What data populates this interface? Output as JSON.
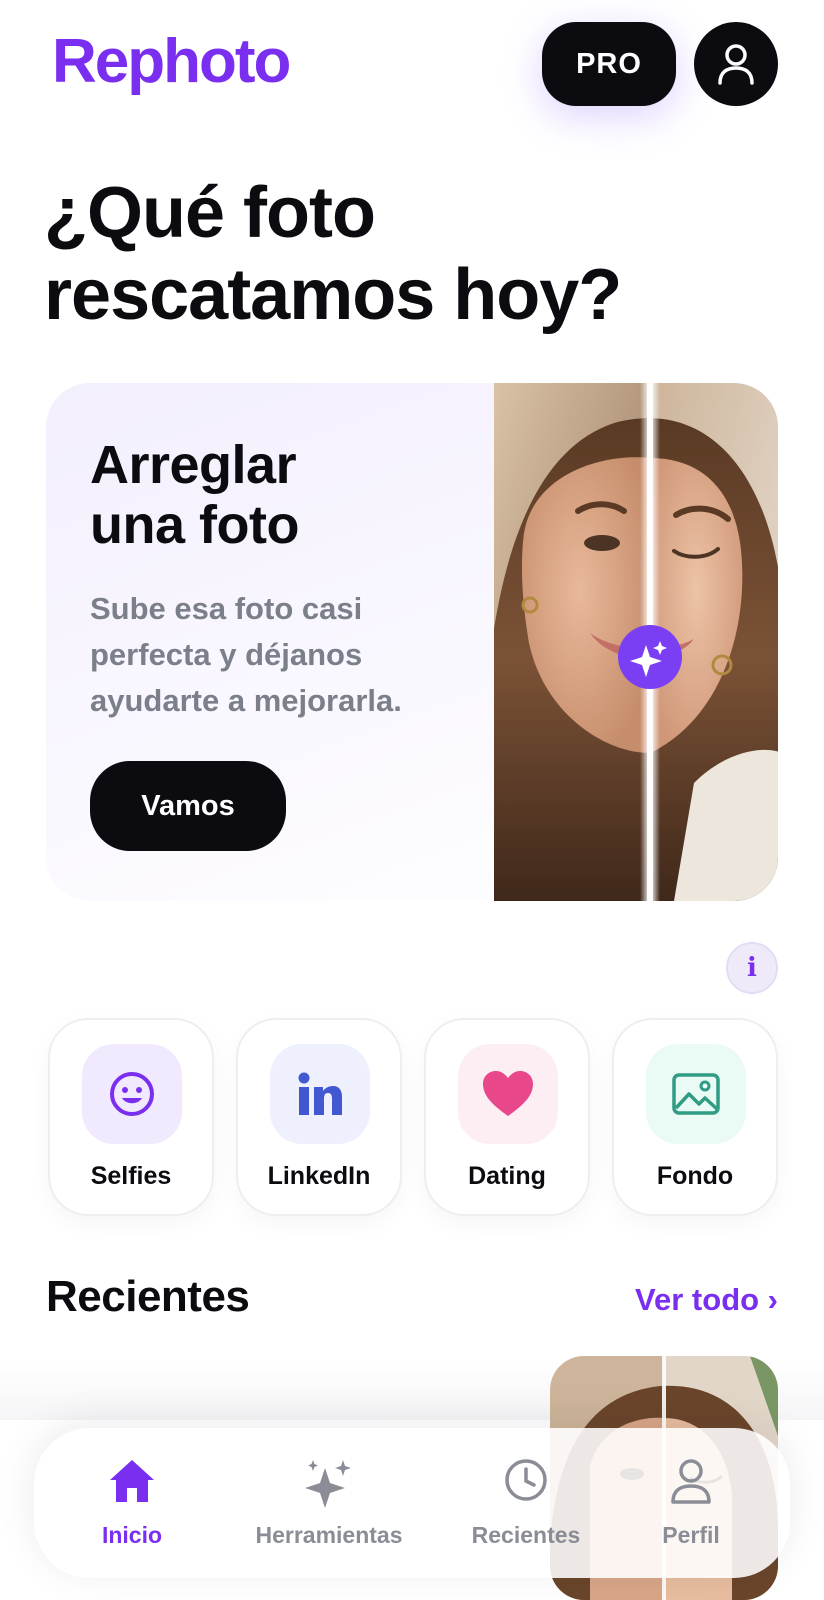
{
  "header": {
    "logo_text": "Rephoto",
    "pro_label": "PRO",
    "profile_icon": "user-icon"
  },
  "headline": {
    "line1": "¿Qué foto",
    "line2": "rescatamos hoy?"
  },
  "hero": {
    "title_line1": "Arreglar",
    "title_line2": "una foto",
    "subtitle": "Sube esa foto casi perfecta y déjanos ayudarte a mejorarla.",
    "cta": "Vamos",
    "badge_icon": "sparkles-icon"
  },
  "info": {
    "label": "i"
  },
  "tools": [
    {
      "label": "Selfies",
      "icon": "smiley-icon",
      "bg": "#f1e9fe",
      "color": "#7a2ef0"
    },
    {
      "label": "LinkedIn",
      "icon": "linkedin-icon",
      "bg": "#eef0fd",
      "color": "#4258d0"
    },
    {
      "label": "Dating",
      "icon": "heart-icon",
      "bg": "#fdeef4",
      "color": "#e8478a"
    },
    {
      "label": "Fondo",
      "icon": "image-icon",
      "bg": "#eafbf6",
      "color": "#2f9c83"
    }
  ],
  "recents": {
    "title": "Recientes",
    "see_all": "Ver todo ›"
  },
  "nav": [
    {
      "label": "Inicio",
      "icon": "home-icon",
      "active": true
    },
    {
      "label": "Herramientas",
      "icon": "sparkles-icon",
      "active": false
    },
    {
      "label": "Recientes",
      "icon": "clock-icon",
      "active": false
    },
    {
      "label": "Perfil",
      "icon": "user-icon",
      "active": false
    }
  ],
  "colors": {
    "accent": "#7a2ef0",
    "dark": "#0b0b10",
    "muted": "#8a8d96"
  }
}
